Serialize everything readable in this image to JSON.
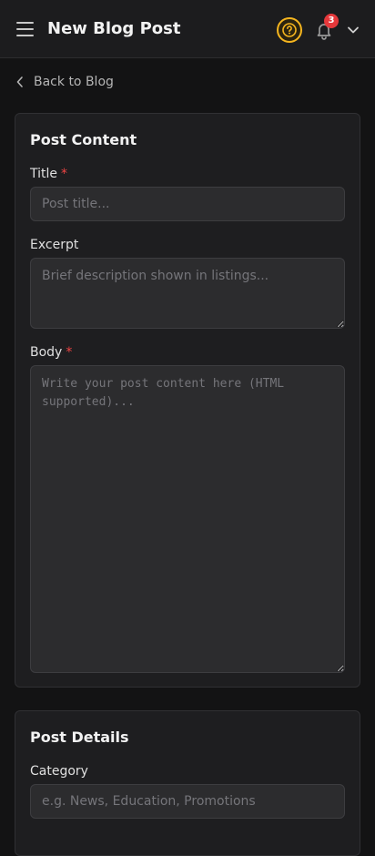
{
  "header": {
    "title": "New Blog Post",
    "notification_count": "3",
    "icons": [
      "menu-icon",
      "help-icon",
      "bell-icon",
      "chevron-down-icon"
    ],
    "accent_color": "#f5b51f",
    "badge_color": "#e5383b"
  },
  "back_link": {
    "label": "Back to Blog",
    "icon": "chevron-left-icon"
  },
  "post_content": {
    "title": "Post Content",
    "fields": {
      "title": {
        "label": "Title",
        "required_mark": "*",
        "value": "",
        "placeholder": "Post title..."
      },
      "excerpt": {
        "label": "Excerpt",
        "value": "",
        "placeholder": "Brief description shown in listings..."
      },
      "body": {
        "label": "Body",
        "required_mark": "*",
        "value": "",
        "placeholder": "Write your post content here (HTML supported)..."
      }
    }
  },
  "post_details": {
    "title": "Post Details",
    "fields": {
      "category": {
        "label": "Category",
        "value": "",
        "placeholder": "e.g. News, Education, Promotions"
      }
    }
  }
}
